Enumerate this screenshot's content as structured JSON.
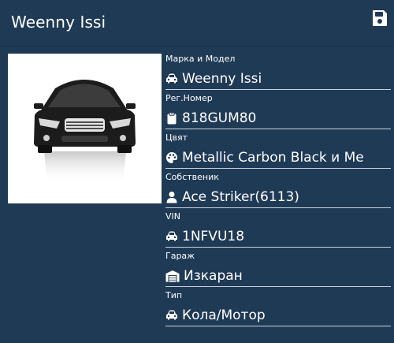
{
  "header": {
    "title": "Weenny Issi",
    "save_icon": "floppy-disk-icon"
  },
  "photo": {
    "icon": "car-front-photo"
  },
  "fields": [
    {
      "label": "Марка и Модел",
      "value": "Weenny Issi",
      "icon": "car-icon"
    },
    {
      "label": "Рег.Номер",
      "value": "818GUM80",
      "icon": "clipboard-icon"
    },
    {
      "label": "Цвят",
      "value": "Metallic Carbon Black и Me",
      "icon": "palette-icon"
    },
    {
      "label": "Собственик",
      "value": "Ace Striker(6113)",
      "icon": "user-icon"
    },
    {
      "label": "VIN",
      "value": "1NFVU18",
      "icon": "car-icon"
    },
    {
      "label": "Гараж",
      "value": "Изкаран",
      "icon": "warehouse-icon"
    },
    {
      "label": "Тип",
      "value": "Кола/Мотор",
      "icon": "car-icon"
    }
  ],
  "colors": {
    "background": "#1f3a55",
    "text": "#ffffff",
    "divider": "#c9d3dd"
  }
}
